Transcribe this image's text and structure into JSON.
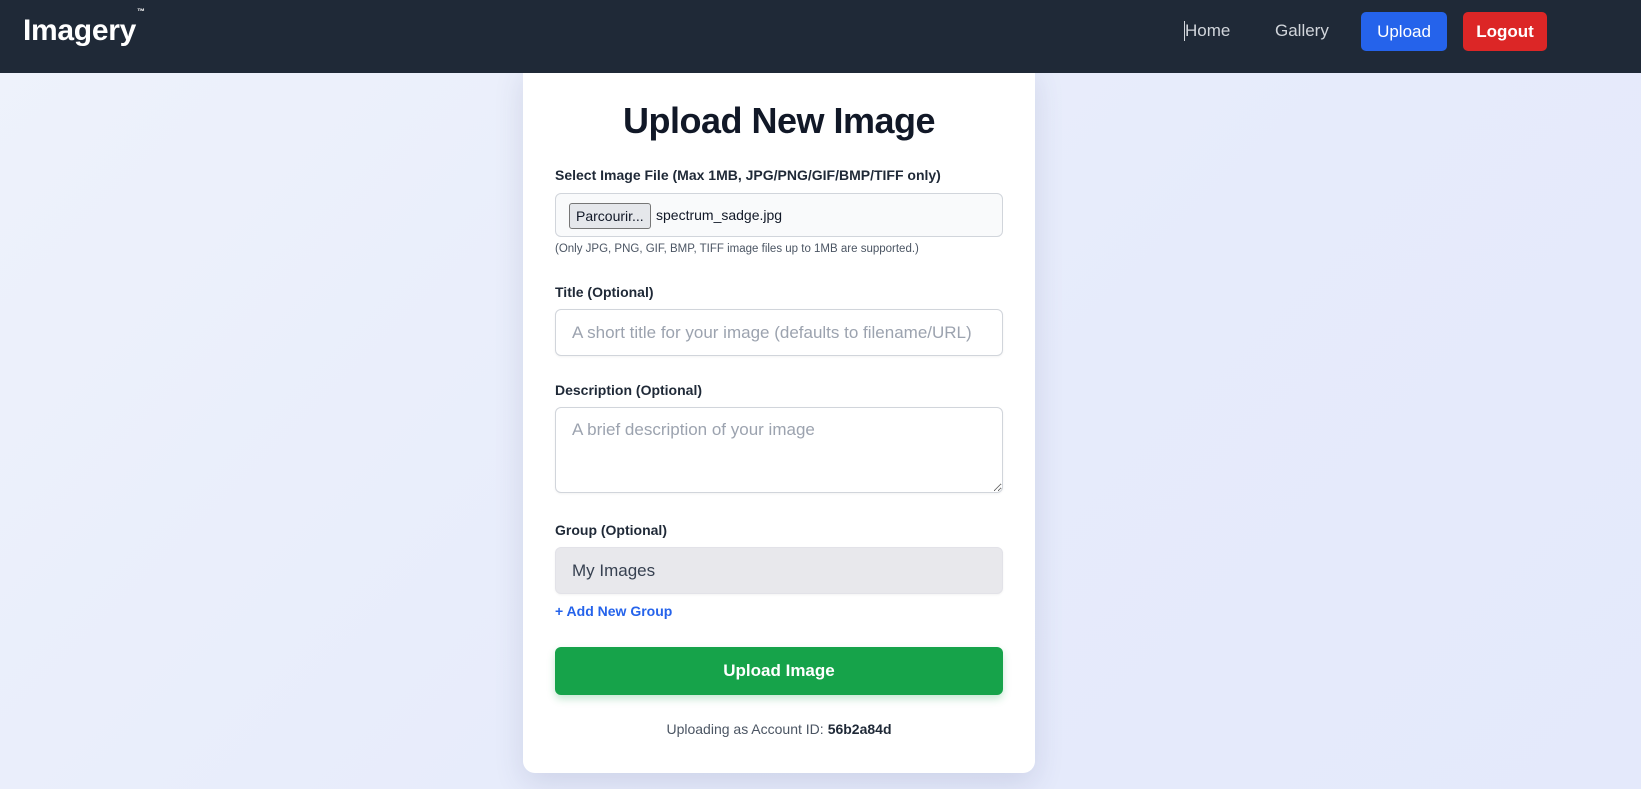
{
  "nav": {
    "brand": "Imagery",
    "brand_mark": "™",
    "links": {
      "home": "Home",
      "gallery": "Gallery",
      "upload": "Upload",
      "logout": "Logout"
    },
    "colors": {
      "bar": "#1f2937",
      "upload": "#2563eb",
      "logout": "#dc2626"
    }
  },
  "form": {
    "title": "Upload New Image",
    "file": {
      "label": "Select Image File (Max 1MB, JPG/PNG/GIF/BMP/TIFF only)",
      "button_label": "Parcourir...",
      "file_name": "spectrum_sadge.jpg",
      "hint": "(Only JPG, PNG, GIF, BMP, TIFF image files up to 1MB are supported.)"
    },
    "title_field": {
      "label": "Title (Optional)",
      "value": "",
      "placeholder": "A short title for your image (defaults to filename/URL)"
    },
    "description_field": {
      "label": "Description (Optional)",
      "value": "",
      "placeholder": "A brief description of your image"
    },
    "group_field": {
      "label": "Group (Optional)",
      "selected": "My Images"
    },
    "add_group_link": "+ Add New Group",
    "submit_label": "Upload Image",
    "submit_color": "#16a34a",
    "account": {
      "prefix": "Uploading as Account ID:",
      "id": "56b2a84d"
    }
  }
}
